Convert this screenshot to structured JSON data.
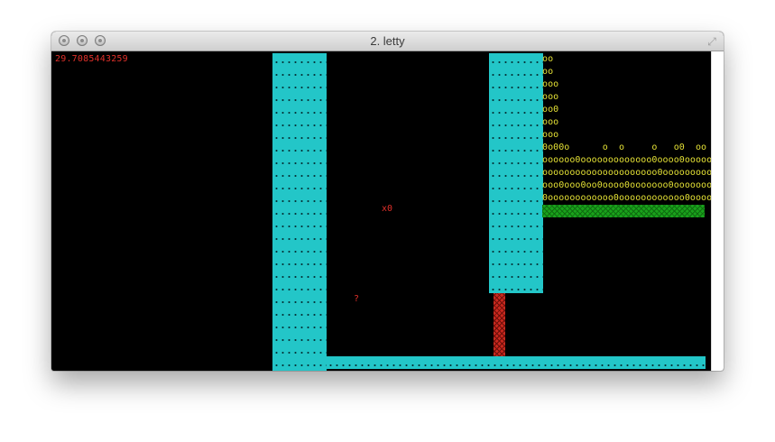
{
  "window": {
    "title": "2. letty"
  },
  "icons": {
    "close": "close-circle-icon",
    "minimize": "minimize-circle-icon",
    "zoom": "zoom-circle-icon",
    "fullscreen": "fullscreen-arrows-icon"
  },
  "terminal": {
    "counter": "29.7085443259",
    "rows": [
      "oo",
      "oo",
      "ooo",
      "ooo",
      "oo0",
      "ooo",
      "ooo",
      "0o00o      o  o     o   o0  oo",
      "oooooo0ooooooooooooo0oooo0oooooo",
      "ooooooooooooooooooooo0oooooooooo",
      "ooo0ooo0oo0oooo0ooooooo0oooooooo",
      "0oooooooooooo0oooooooooooo0ooooo"
    ],
    "player_glyph": "x0",
    "enemy_glyph": "x",
    "pit_glyph": "?"
  },
  "colors": {
    "background": "#000000",
    "wall": "#23c6c8",
    "coins": "#e3e035",
    "grass": "#19a21b",
    "lava": "#c8281e",
    "counter": "#e0302a"
  }
}
